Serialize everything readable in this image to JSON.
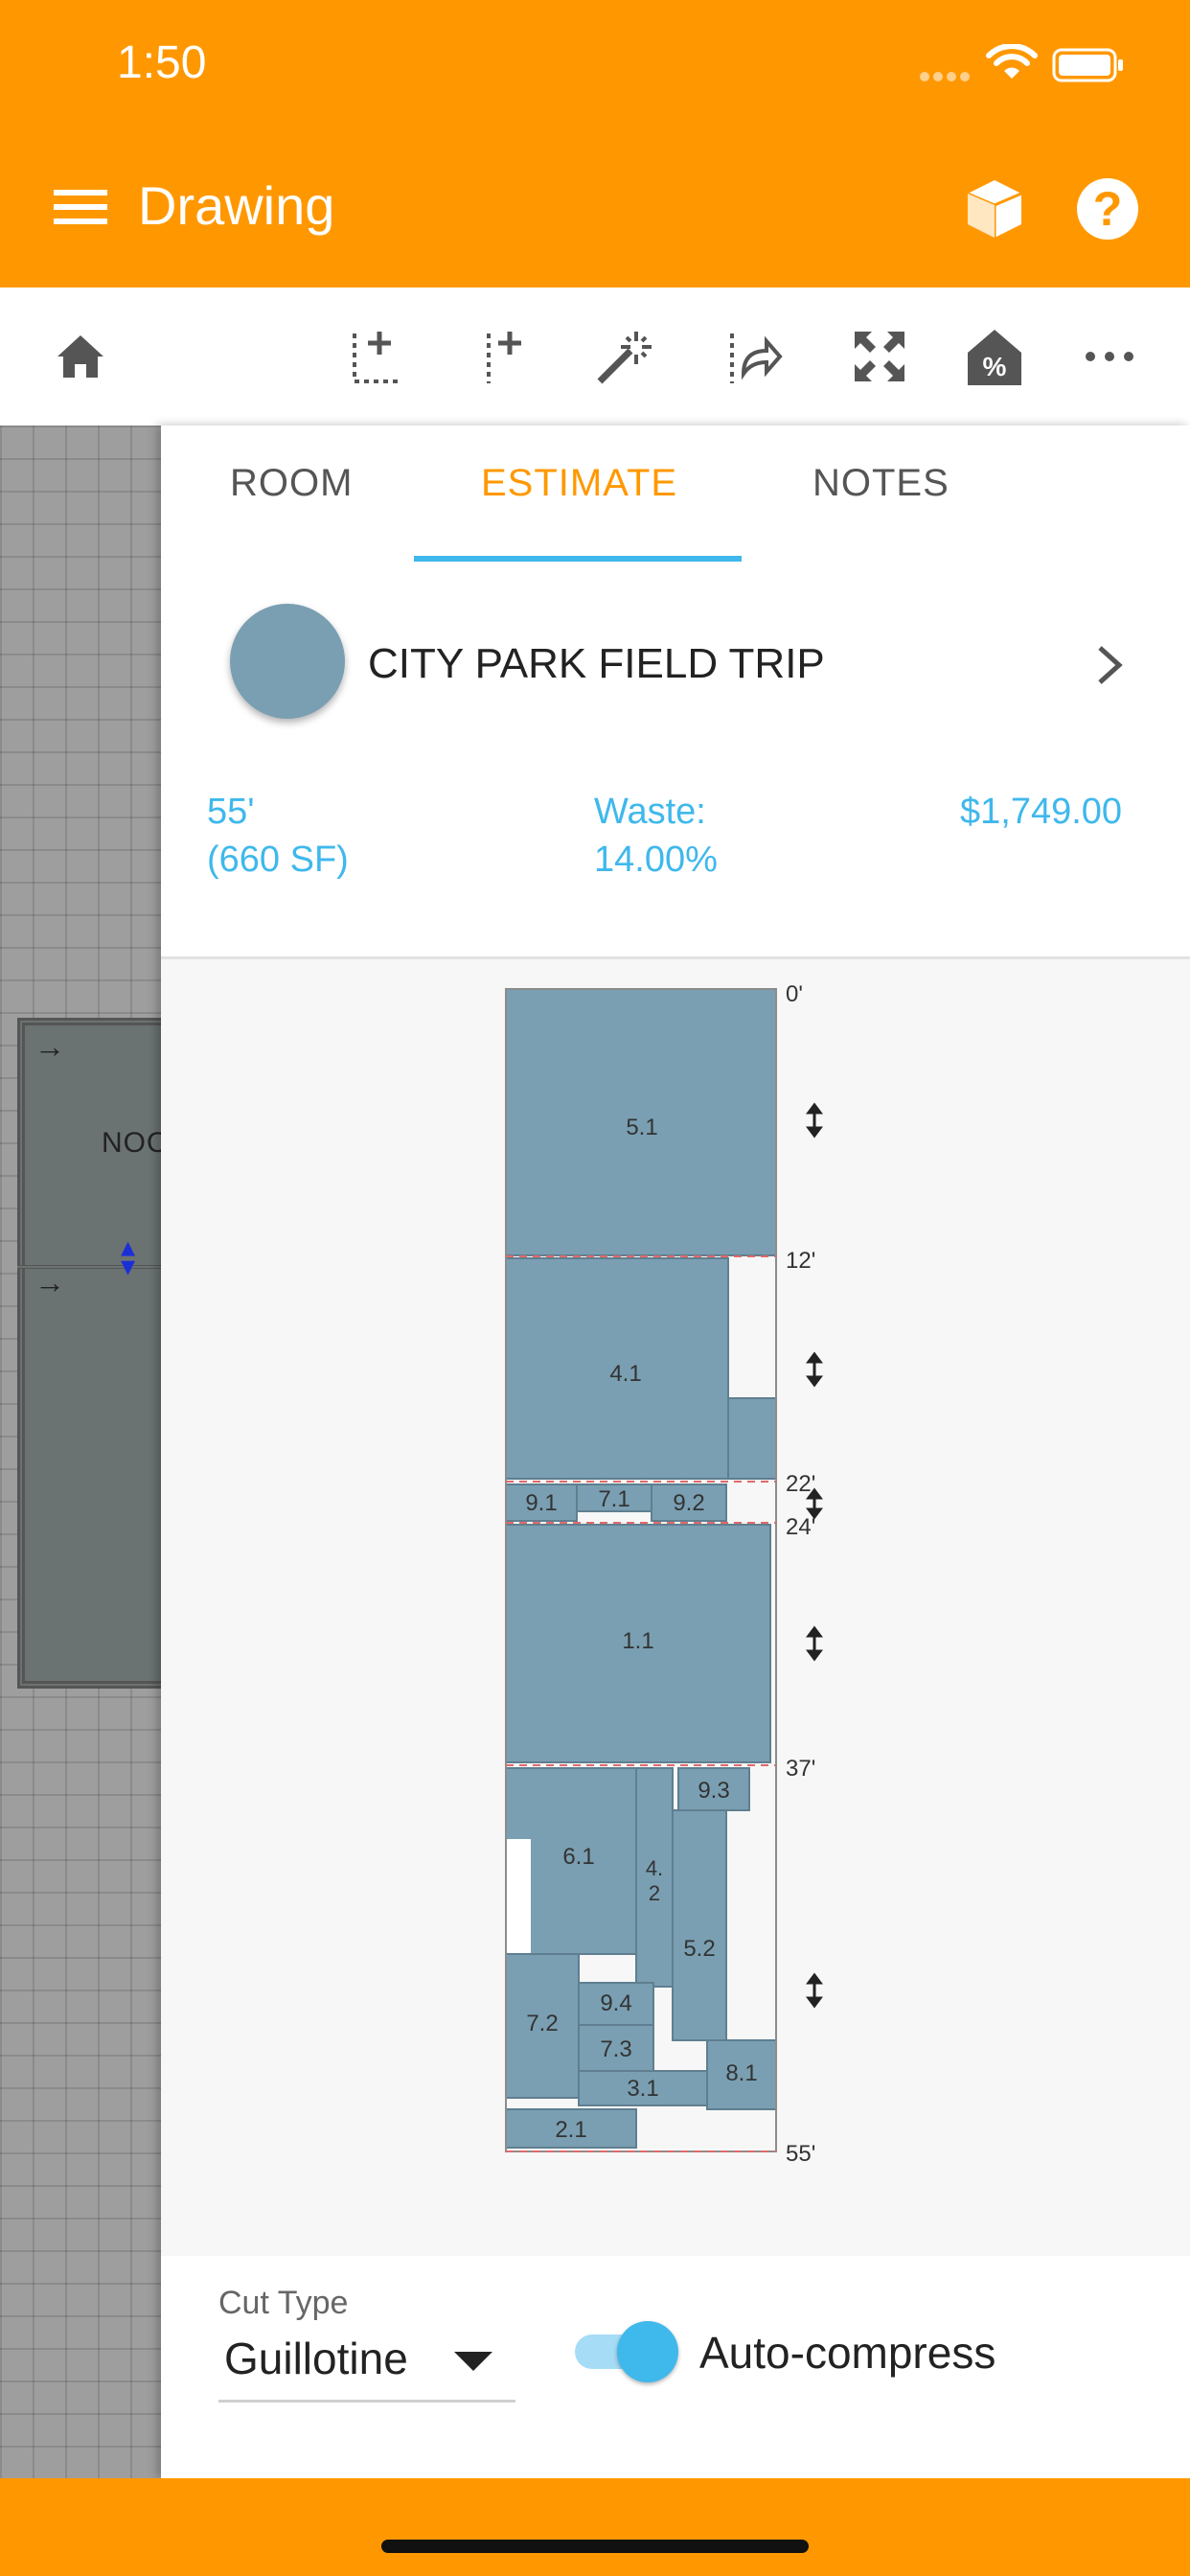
{
  "status_bar": {
    "time": "1:50"
  },
  "header": {
    "title": "Drawing"
  },
  "toolbar": {
    "icons": [
      "home-icon",
      "add-point-icon",
      "add-line-icon",
      "magic-wand-icon",
      "share-icon",
      "fullscreen-icon",
      "house-percent-icon",
      "more-icon"
    ]
  },
  "canvas": {
    "room_label": "NOO"
  },
  "panel": {
    "tabs": [
      {
        "label": "ROOM",
        "active": false
      },
      {
        "label": "ESTIMATE",
        "active": true
      },
      {
        "label": "NOTES",
        "active": false
      }
    ],
    "material": {
      "name": "CITY PARK FIELD TRIP",
      "color": "#7a9fb2"
    },
    "stats": {
      "length": "55'",
      "area": "(660 SF)",
      "waste_label": "Waste:",
      "waste_value": "14.00%",
      "price": "$1,749.00"
    },
    "cut_layout": {
      "markers": [
        "0'",
        "12'",
        "22'",
        "24'",
        "37'",
        "55'"
      ],
      "pieces": [
        "5.1",
        "4.1",
        "9.1",
        "7.1",
        "9.2",
        "1.1",
        "9.3",
        "6.1",
        "4.2",
        "5.2",
        "9.4",
        "7.2",
        "7.3",
        "8.1",
        "3.1",
        "2.1"
      ]
    },
    "cut_type": {
      "label": "Cut Type",
      "value": "Guillotine"
    },
    "auto_compress": {
      "label": "Auto-compress",
      "on": true
    }
  },
  "colors": {
    "accent": "#FF9800",
    "highlight": "#3fb8ec",
    "piece": "#7a9fb2"
  }
}
